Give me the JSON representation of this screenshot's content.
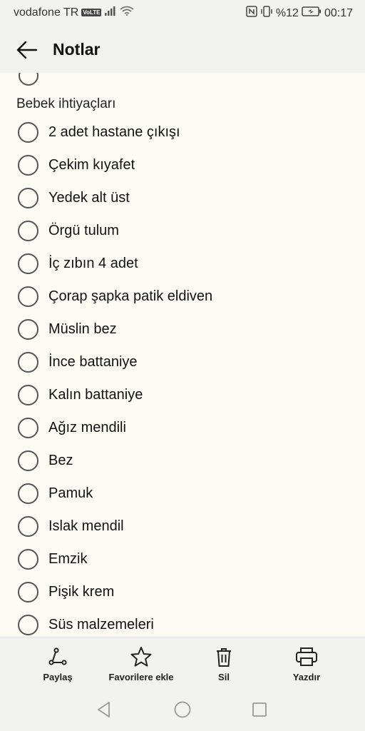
{
  "status_bar": {
    "carrier": "vodafone TR",
    "volte": "VoLTE",
    "battery_percent": "%12",
    "time": "00:17"
  },
  "app_bar": {
    "title": "Notlar",
    "back_icon": "arrow-left-icon"
  },
  "note": {
    "section_title": "Bebek ihtiyaçları",
    "items": [
      {
        "label": "2 adet hastane çıkışı",
        "checked": false
      },
      {
        "label": "Çekim kıyafet",
        "checked": false
      },
      {
        "label": "Yedek alt üst",
        "checked": false
      },
      {
        "label": "Örgü tulum",
        "checked": false
      },
      {
        "label": "İç zıbın 4 adet",
        "checked": false
      },
      {
        "label": "Çorap şapka patik eldiven",
        "checked": false
      },
      {
        "label": "Müslin bez",
        "checked": false
      },
      {
        "label": "İnce battaniye",
        "checked": false
      },
      {
        "label": "Kalın battaniye",
        "checked": false
      },
      {
        "label": "Ağız mendili",
        "checked": false
      },
      {
        "label": "Bez",
        "checked": false
      },
      {
        "label": "Pamuk",
        "checked": false
      },
      {
        "label": "Islak mendil",
        "checked": false
      },
      {
        "label": "Emzik",
        "checked": false
      },
      {
        "label": "Pişik krem",
        "checked": false
      },
      {
        "label": "Süs malzemeleri",
        "checked": false
      }
    ]
  },
  "bottom_actions": [
    {
      "label": "Paylaş",
      "icon": "share-icon"
    },
    {
      "label": "Favorilere ekle",
      "icon": "star-icon"
    },
    {
      "label": "Sil",
      "icon": "trash-icon"
    },
    {
      "label": "Yazdır",
      "icon": "printer-icon"
    }
  ],
  "nav_bar": {
    "back_icon": "nav-back-icon",
    "home_icon": "nav-home-icon",
    "recents_icon": "nav-recents-icon"
  }
}
